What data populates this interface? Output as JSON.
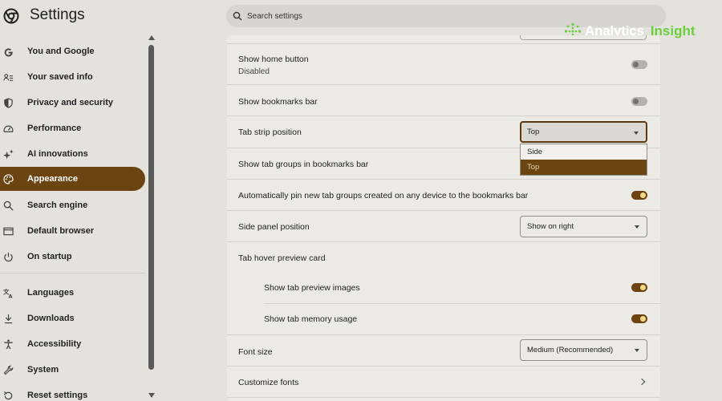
{
  "header": {
    "title": "Settings",
    "search_placeholder": "Search settings"
  },
  "watermark": {
    "text_1": "Analytics",
    "text_2": "Insight"
  },
  "sidebar": {
    "items": [
      {
        "label": "You and Google",
        "icon": "google-icon"
      },
      {
        "label": "Your saved info",
        "icon": "saved-info-icon"
      },
      {
        "label": "Privacy and security",
        "icon": "shield-icon"
      },
      {
        "label": "Performance",
        "icon": "speedometer-icon"
      },
      {
        "label": "AI innovations",
        "icon": "sparkle-icon"
      },
      {
        "label": "Appearance",
        "icon": "palette-icon",
        "active": true
      },
      {
        "label": "Search engine",
        "icon": "search-icon"
      },
      {
        "label": "Default browser",
        "icon": "browser-window-icon"
      },
      {
        "label": "On startup",
        "icon": "power-icon"
      },
      {
        "label": "Languages",
        "icon": "translate-icon"
      },
      {
        "label": "Downloads",
        "icon": "download-icon"
      },
      {
        "label": "Accessibility",
        "icon": "accessibility-icon"
      },
      {
        "label": "System",
        "icon": "wrench-icon"
      },
      {
        "label": "Reset settings",
        "icon": "reset-icon"
      }
    ]
  },
  "settings": {
    "home_button": {
      "label": "Show home button",
      "sub": "Disabled",
      "enabled": false
    },
    "bookmarks_bar": {
      "label": "Show bookmarks bar",
      "enabled": false
    },
    "tab_strip": {
      "label": "Tab strip position",
      "value": "Top",
      "options": [
        "Side",
        "Top"
      ],
      "highlighted": "Top"
    },
    "tab_groups_bookmarks": {
      "label": "Show tab groups in bookmarks bar"
    },
    "auto_pin": {
      "label": "Automatically pin new tab groups created on any device to the bookmarks bar",
      "enabled": true
    },
    "side_panel": {
      "label": "Side panel position",
      "value": "Show on right"
    },
    "hover_card": {
      "label": "Tab hover preview card"
    },
    "preview_images": {
      "label": "Show tab preview images",
      "enabled": true
    },
    "memory_usage": {
      "label": "Show tab memory usage",
      "enabled": true
    },
    "font_size": {
      "label": "Font size",
      "value": "Medium (Recommended)"
    },
    "customize_fonts": {
      "label": "Customize fonts"
    }
  },
  "colors": {
    "accent": "#6b4412",
    "toggle_knob_on": "#f5d887",
    "background": "#e3e2dc",
    "panel": "#ebeae4"
  }
}
